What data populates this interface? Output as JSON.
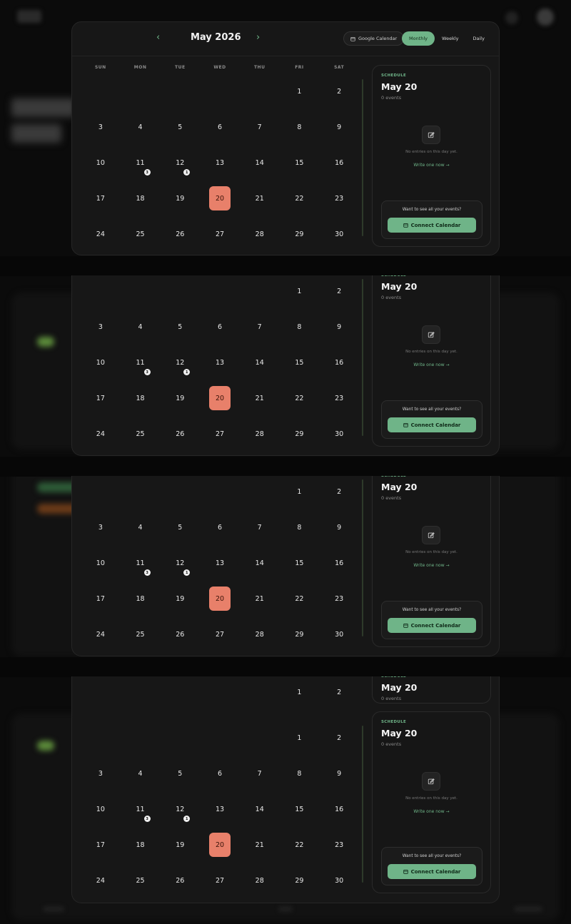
{
  "header": {
    "month": "May 2026",
    "google_calendar": "Google Calendar",
    "views": [
      "Monthly",
      "Weekly",
      "Daily"
    ],
    "active_view": "Monthly"
  },
  "weekdays": [
    "SUN",
    "MON",
    "TUE",
    "WED",
    "THU",
    "FRI",
    "SAT"
  ],
  "calendar": {
    "leading_blanks": 5,
    "days": 30,
    "today": 20,
    "event_counts": {
      "11": "3",
      "12": "1"
    }
  },
  "schedule": {
    "label": "SCHEDULE",
    "date": "May 20",
    "count": "0 events",
    "empty_text": "No entries on this day yet.",
    "write_link": "Write one now →",
    "connect_question": "Want to see all your events?",
    "connect_button": "Connect Calendar"
  },
  "colors": {
    "accent": "#6fb488",
    "today": "#e8806a",
    "panel": "#171717",
    "background": "#0b0b0b"
  }
}
